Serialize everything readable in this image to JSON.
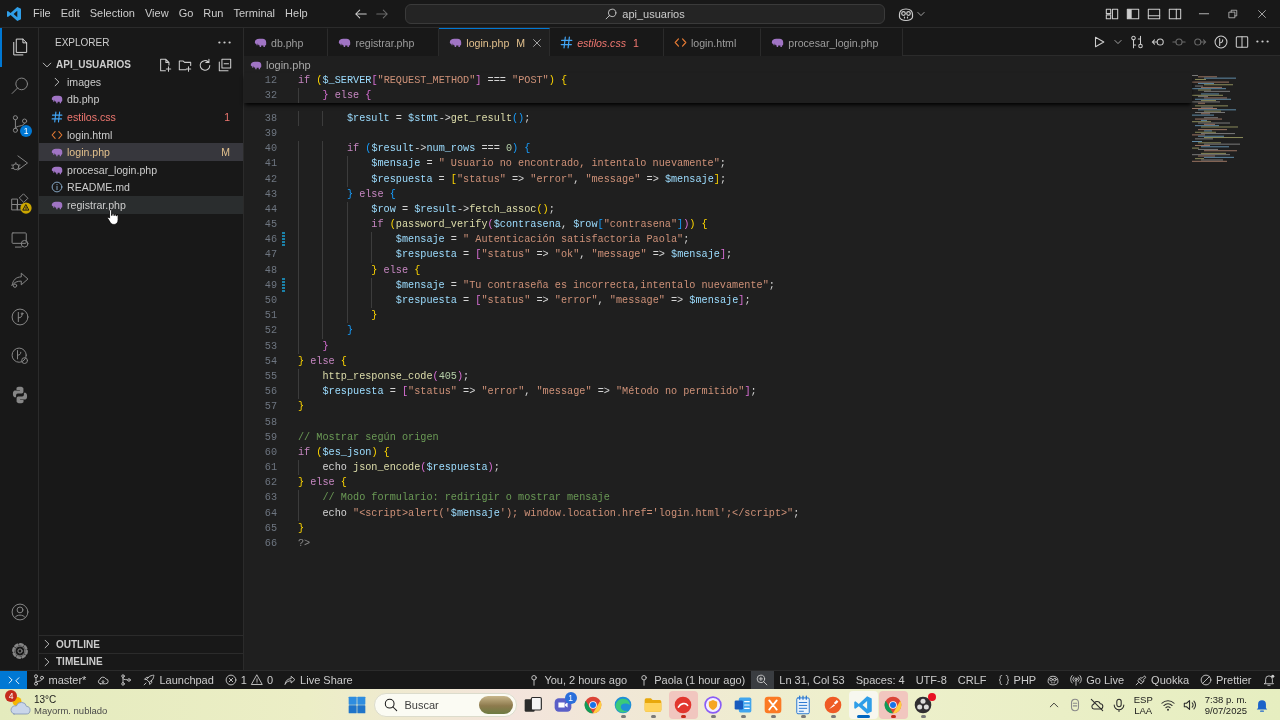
{
  "title_bar": {
    "menu": [
      "File",
      "Edit",
      "Selection",
      "View",
      "Go",
      "Run",
      "Terminal",
      "Help"
    ],
    "command_center": "api_usuarios"
  },
  "activity_bar": {
    "items": [
      {
        "kind": "explorer",
        "selected": true,
        "warning": false
      },
      {
        "kind": "search",
        "selected": false,
        "warning": false
      },
      {
        "kind": "source-control",
        "selected": false,
        "warning": false,
        "badge": "1"
      },
      {
        "kind": "run-debug",
        "selected": false,
        "warning": false
      },
      {
        "kind": "extensions",
        "selected": false,
        "warning": true
      },
      {
        "kind": "remote",
        "selected": false,
        "warning": false
      },
      {
        "kind": "live-share",
        "selected": false,
        "warning": false
      },
      {
        "kind": "git-graph",
        "selected": false,
        "warning": false
      },
      {
        "kind": "testing",
        "selected": false,
        "warning": false
      },
      {
        "kind": "python",
        "selected": false,
        "warning": false
      }
    ],
    "bottom": [
      {
        "kind": "account"
      },
      {
        "kind": "settings"
      }
    ]
  },
  "sidebar": {
    "title": "EXPLORER",
    "section": {
      "label": "API_USUARIOS",
      "expanded": true
    },
    "items": [
      {
        "kind": "folder",
        "label": "images",
        "expanded": false,
        "selected": false,
        "hovered": false
      },
      {
        "kind": "php",
        "label": "db.php",
        "selected": false,
        "hovered": false
      },
      {
        "kind": "css",
        "label": "estilos.css",
        "selected": false,
        "hovered": false,
        "decoration": {
          "kind": "error",
          "text": "1"
        }
      },
      {
        "kind": "html",
        "label": "login.html",
        "selected": false,
        "hovered": false
      },
      {
        "kind": "php",
        "label": "login.php",
        "selected": true,
        "hovered": false,
        "decoration": {
          "kind": "modified",
          "text": "M"
        }
      },
      {
        "kind": "php",
        "label": "procesar_login.php",
        "selected": false,
        "hovered": false
      },
      {
        "kind": "info",
        "label": "README.md",
        "selected": false,
        "hovered": false
      },
      {
        "kind": "php",
        "label": "registrar.php",
        "selected": false,
        "hovered": true
      }
    ],
    "panels": [
      {
        "label": "OUTLINE",
        "expanded": false
      },
      {
        "label": "TIMELINE",
        "expanded": false
      }
    ]
  },
  "editor": {
    "tabs": [
      {
        "kind": "php",
        "label": "db.php",
        "selected": false,
        "preview": false
      },
      {
        "kind": "php",
        "label": "registrar.php",
        "selected": false,
        "preview": false
      },
      {
        "kind": "php",
        "label": "login.php",
        "selected": true,
        "preview": false,
        "decoration": {
          "kind": "modified",
          "text": "M"
        }
      },
      {
        "kind": "css",
        "label": "estilos.css",
        "selected": false,
        "preview": true,
        "decoration": {
          "kind": "error",
          "text": "1"
        }
      },
      {
        "kind": "html",
        "label": "login.html",
        "selected": false,
        "preview": false
      },
      {
        "kind": "php",
        "label": "procesar_login.php",
        "selected": false,
        "preview": false
      }
    ],
    "breadcrumb": {
      "kind": "php",
      "label": "login.php"
    },
    "sticky_lines": [
      {
        "number": "12",
        "code": [
          {
            "kind": "keyword",
            "text": "if "
          },
          {
            "kind": "bracket-1",
            "text": "("
          },
          {
            "kind": "variable",
            "text": "$_SERVER"
          },
          {
            "kind": "bracket-2",
            "text": "["
          },
          {
            "kind": "string",
            "text": "\"REQUEST_METHOD\""
          },
          {
            "kind": "bracket-2",
            "text": "]"
          },
          {
            "kind": "plain",
            "text": " === "
          },
          {
            "kind": "string",
            "text": "\"POST\""
          },
          {
            "kind": "bracket-1",
            "text": ") {"
          }
        ]
      },
      {
        "number": "32",
        "code": [
          {
            "kind": "bracket-2",
            "text": "    }"
          },
          {
            "kind": "keyword",
            "text": " else "
          },
          {
            "kind": "bracket-2",
            "text": "{"
          }
        ]
      }
    ],
    "lines": [
      {
        "number": "38",
        "modified": false,
        "code": [
          {
            "kind": "variable",
            "text": "        $result"
          },
          {
            "kind": "plain",
            "text": " = "
          },
          {
            "kind": "variable",
            "text": "$stmt"
          },
          {
            "kind": "plain",
            "text": "->"
          },
          {
            "kind": "function",
            "text": "get_result"
          },
          {
            "kind": "bracket-3",
            "text": "()"
          },
          {
            "kind": "plain",
            "text": ";"
          }
        ]
      },
      {
        "number": "39",
        "modified": false
      },
      {
        "number": "40",
        "modified": false,
        "code": [
          {
            "kind": "keyword",
            "text": "        if "
          },
          {
            "kind": "bracket-3",
            "text": "("
          },
          {
            "kind": "variable",
            "text": "$result"
          },
          {
            "kind": "plain",
            "text": "->"
          },
          {
            "kind": "variable",
            "text": "num_rows"
          },
          {
            "kind": "plain",
            "text": " === "
          },
          {
            "kind": "number",
            "text": "0"
          },
          {
            "kind": "bracket-3",
            "text": ") {"
          }
        ]
      },
      {
        "number": "41",
        "modified": false,
        "code": [
          {
            "kind": "variable",
            "text": "            $mensaje"
          },
          {
            "kind": "plain",
            "text": " = "
          },
          {
            "kind": "string",
            "text": "\" Usuario no encontrado, intentalo nuevamente\""
          },
          {
            "kind": "plain",
            "text": ";"
          }
        ]
      },
      {
        "number": "42",
        "modified": false,
        "code": [
          {
            "kind": "variable",
            "text": "            $respuesta"
          },
          {
            "kind": "plain",
            "text": " = "
          },
          {
            "kind": "bracket-1",
            "text": "["
          },
          {
            "kind": "string",
            "text": "\"status\""
          },
          {
            "kind": "plain",
            "text": " => "
          },
          {
            "kind": "string",
            "text": "\"error\""
          },
          {
            "kind": "plain",
            "text": ", "
          },
          {
            "kind": "string",
            "text": "\"message\""
          },
          {
            "kind": "plain",
            "text": " => "
          },
          {
            "kind": "variable",
            "text": "$mensaje"
          },
          {
            "kind": "bracket-1",
            "text": "]"
          },
          {
            "kind": "plain",
            "text": ";"
          }
        ]
      },
      {
        "number": "43",
        "modified": false,
        "code": [
          {
            "kind": "bracket-3",
            "text": "        }"
          },
          {
            "kind": "keyword",
            "text": " else "
          },
          {
            "kind": "bracket-3",
            "text": "{"
          }
        ]
      },
      {
        "number": "44",
        "modified": false,
        "code": [
          {
            "kind": "variable",
            "text": "            $row"
          },
          {
            "kind": "plain",
            "text": " = "
          },
          {
            "kind": "variable",
            "text": "$result"
          },
          {
            "kind": "plain",
            "text": "->"
          },
          {
            "kind": "function",
            "text": "fetch_assoc"
          },
          {
            "kind": "bracket-1",
            "text": "()"
          },
          {
            "kind": "plain",
            "text": ";"
          }
        ]
      },
      {
        "number": "45",
        "modified": false,
        "code": [
          {
            "kind": "keyword",
            "text": "            if "
          },
          {
            "kind": "bracket-1",
            "text": "("
          },
          {
            "kind": "function",
            "text": "password_verify"
          },
          {
            "kind": "bracket-2",
            "text": "("
          },
          {
            "kind": "variable",
            "text": "$contrasena"
          },
          {
            "kind": "plain",
            "text": ", "
          },
          {
            "kind": "variable",
            "text": "$row"
          },
          {
            "kind": "bracket-3",
            "text": "["
          },
          {
            "kind": "string",
            "text": "\"contrasena\""
          },
          {
            "kind": "bracket-3",
            "text": "]"
          },
          {
            "kind": "bracket-2",
            "text": ")"
          },
          {
            "kind": "bracket-1",
            "text": ") {"
          }
        ]
      },
      {
        "number": "46",
        "modified": true,
        "code": [
          {
            "kind": "variable",
            "text": "                $mensaje"
          },
          {
            "kind": "plain",
            "text": " = "
          },
          {
            "kind": "string",
            "text": "\" Autenticación satisfactoria Paola\""
          },
          {
            "kind": "plain",
            "text": ";"
          }
        ]
      },
      {
        "number": "47",
        "modified": false,
        "code": [
          {
            "kind": "variable",
            "text": "                $respuesta"
          },
          {
            "kind": "plain",
            "text": " = "
          },
          {
            "kind": "bracket-2",
            "text": "["
          },
          {
            "kind": "string",
            "text": "\"status\""
          },
          {
            "kind": "plain",
            "text": " => "
          },
          {
            "kind": "string",
            "text": "\"ok\""
          },
          {
            "kind": "plain",
            "text": ", "
          },
          {
            "kind": "string",
            "text": "\"message\""
          },
          {
            "kind": "plain",
            "text": " => "
          },
          {
            "kind": "variable",
            "text": "$mensaje"
          },
          {
            "kind": "bracket-2",
            "text": "]"
          },
          {
            "kind": "plain",
            "text": ";"
          }
        ]
      },
      {
        "number": "48",
        "modified": false,
        "code": [
          {
            "kind": "bracket-1",
            "text": "            }"
          },
          {
            "kind": "keyword",
            "text": " else "
          },
          {
            "kind": "bracket-1",
            "text": "{"
          }
        ]
      },
      {
        "number": "49",
        "modified": true,
        "code": [
          {
            "kind": "variable",
            "text": "                $mensaje"
          },
          {
            "kind": "plain",
            "text": " = "
          },
          {
            "kind": "string",
            "text": "\"Tu contraseña es incorrecta,intentalo nuevamente\""
          },
          {
            "kind": "plain",
            "text": ";"
          }
        ]
      },
      {
        "number": "50",
        "modified": false,
        "code": [
          {
            "kind": "variable",
            "text": "                $respuesta"
          },
          {
            "kind": "plain",
            "text": " = "
          },
          {
            "kind": "bracket-2",
            "text": "["
          },
          {
            "kind": "string",
            "text": "\"status\""
          },
          {
            "kind": "plain",
            "text": " => "
          },
          {
            "kind": "string",
            "text": "\"error\""
          },
          {
            "kind": "plain",
            "text": ", "
          },
          {
            "kind": "string",
            "text": "\"message\""
          },
          {
            "kind": "plain",
            "text": " => "
          },
          {
            "kind": "variable",
            "text": "$mensaje"
          },
          {
            "kind": "bracket-2",
            "text": "]"
          },
          {
            "kind": "plain",
            "text": ";"
          }
        ]
      },
      {
        "number": "51",
        "modified": false,
        "code": [
          {
            "kind": "bracket-1",
            "text": "            }"
          }
        ]
      },
      {
        "number": "52",
        "modified": false,
        "code": [
          {
            "kind": "bracket-3",
            "text": "        }"
          }
        ]
      },
      {
        "number": "53",
        "modified": false,
        "code": [
          {
            "kind": "bracket-2",
            "text": "    }"
          }
        ]
      },
      {
        "number": "54",
        "modified": false,
        "code": [
          {
            "kind": "bracket-1",
            "text": "}"
          },
          {
            "kind": "keyword",
            "text": " else "
          },
          {
            "kind": "bracket-1",
            "text": "{"
          }
        ]
      },
      {
        "number": "55",
        "modified": false,
        "code": [
          {
            "kind": "function",
            "text": "    http_response_code"
          },
          {
            "kind": "bracket-2",
            "text": "("
          },
          {
            "kind": "number",
            "text": "405"
          },
          {
            "kind": "bracket-2",
            "text": ")"
          },
          {
            "kind": "plain",
            "text": ";"
          }
        ]
      },
      {
        "number": "56",
        "modified": false,
        "code": [
          {
            "kind": "variable",
            "text": "    $respuesta"
          },
          {
            "kind": "plain",
            "text": " = "
          },
          {
            "kind": "bracket-2",
            "text": "["
          },
          {
            "kind": "string",
            "text": "\"status\""
          },
          {
            "kind": "plain",
            "text": " => "
          },
          {
            "kind": "string",
            "text": "\"error\""
          },
          {
            "kind": "plain",
            "text": ", "
          },
          {
            "kind": "string",
            "text": "\"message\""
          },
          {
            "kind": "plain",
            "text": " => "
          },
          {
            "kind": "string",
            "text": "\"Método no permitido\""
          },
          {
            "kind": "bracket-2",
            "text": "]"
          },
          {
            "kind": "plain",
            "text": ";"
          }
        ]
      },
      {
        "number": "57",
        "modified": false,
        "code": [
          {
            "kind": "bracket-1",
            "text": "}"
          }
        ]
      },
      {
        "number": "58",
        "modified": false
      },
      {
        "number": "59",
        "modified": false,
        "code": [
          {
            "kind": "comment",
            "text": "// Mostrar según origen"
          }
        ]
      },
      {
        "number": "60",
        "modified": false,
        "code": [
          {
            "kind": "keyword",
            "text": "if "
          },
          {
            "kind": "bracket-1",
            "text": "("
          },
          {
            "kind": "variable",
            "text": "$es_json"
          },
          {
            "kind": "bracket-1",
            "text": ") {"
          }
        ]
      },
      {
        "number": "61",
        "modified": false,
        "code": [
          {
            "kind": "plain",
            "text": "    echo "
          },
          {
            "kind": "function",
            "text": "json_encode"
          },
          {
            "kind": "bracket-2",
            "text": "("
          },
          {
            "kind": "variable",
            "text": "$respuesta"
          },
          {
            "kind": "bracket-2",
            "text": ")"
          },
          {
            "kind": "plain",
            "text": ";"
          }
        ]
      },
      {
        "number": "62",
        "modified": false,
        "code": [
          {
            "kind": "bracket-1",
            "text": "}"
          },
          {
            "kind": "keyword",
            "text": " else "
          },
          {
            "kind": "bracket-1",
            "text": "{"
          }
        ]
      },
      {
        "number": "63",
        "modified": false,
        "code": [
          {
            "kind": "comment",
            "text": "    // Modo formulario: redirigir o mostrar mensaje"
          }
        ]
      },
      {
        "number": "64",
        "modified": false,
        "code": [
          {
            "kind": "plain",
            "text": "    echo "
          },
          {
            "kind": "string",
            "text": "\"<script>alert('"
          },
          {
            "kind": "variable",
            "text": "$mensaje"
          },
          {
            "kind": "string",
            "text": "'); window.location.href='login.html';</script>\""
          },
          {
            "kind": "plain",
            "text": ";"
          }
        ]
      },
      {
        "number": "65",
        "modified": false,
        "code": [
          {
            "kind": "bracket-1",
            "text": "}"
          }
        ]
      },
      {
        "number": "66",
        "modified": false,
        "code": [
          {
            "kind": "tag",
            "text": "?>"
          }
        ]
      }
    ]
  },
  "status_bar": {
    "left": [
      {
        "kind": "remote"
      },
      {
        "kind": "branch",
        "text": "master*"
      },
      {
        "kind": "sync"
      },
      {
        "kind": "graph"
      },
      {
        "kind": "launchpad",
        "text": "Launchpad"
      },
      {
        "kind": "problems",
        "errors": "1",
        "warnings": "0"
      },
      {
        "kind": "live-share",
        "text": "Live Share"
      }
    ],
    "right": [
      {
        "kind": "blame",
        "text": "You, 2 hours ago",
        "highlighted": false
      },
      {
        "kind": "blame",
        "text": "Paola (1 hour ago)",
        "highlighted": false
      },
      {
        "kind": "zoom",
        "highlighted": true
      },
      {
        "kind": "text",
        "text": "Ln 31, Col 53",
        "highlighted": false
      },
      {
        "kind": "text",
        "text": "Spaces: 4",
        "highlighted": false
      },
      {
        "kind": "text",
        "text": "UTF-8",
        "highlighted": false
      },
      {
        "kind": "text",
        "text": "CRLF",
        "highlighted": false
      },
      {
        "kind": "language",
        "text": "PHP",
        "highlighted": false
      },
      {
        "kind": "copilot",
        "highlighted": false
      },
      {
        "kind": "go-live",
        "text": "Go Live",
        "highlighted": false
      },
      {
        "kind": "quokka",
        "text": "Quokka",
        "highlighted": false
      },
      {
        "kind": "prettier",
        "text": "Prettier",
        "highlighted": false
      },
      {
        "kind": "notifications",
        "highlighted": false
      }
    ]
  },
  "taskbar": {
    "weather": {
      "badge": "4",
      "temperature": "13°C",
      "condition": "Mayorm. nublado"
    },
    "search": {
      "placeholder": "Buscar"
    },
    "apps": [
      {
        "kind": "start",
        "running": false,
        "selected": false,
        "flashing": false,
        "alert": false
      },
      {
        "kind": "task-view",
        "running": false,
        "selected": false,
        "flashing": false,
        "alert": false
      },
      {
        "kind": "chat",
        "badge": "1",
        "running": false,
        "selected": false,
        "flashing": false,
        "alert": false
      },
      {
        "kind": "chrome",
        "running": false,
        "selected": false,
        "flashing": false,
        "alert": false
      },
      {
        "kind": "edge",
        "running": true,
        "selected": false,
        "flashing": false,
        "alert": false
      },
      {
        "kind": "files",
        "running": true,
        "selected": false,
        "flashing": false,
        "alert": false
      },
      {
        "kind": "ea",
        "running": true,
        "selected": false,
        "flashing": true,
        "alert": false
      },
      {
        "kind": "vpn",
        "running": true,
        "selected": false,
        "flashing": false,
        "alert": false
      },
      {
        "kind": "word",
        "running": true,
        "selected": false,
        "flashing": false,
        "alert": false
      },
      {
        "kind": "xampp",
        "running": true,
        "selected": false,
        "flashing": false,
        "alert": false
      },
      {
        "kind": "notepad",
        "running": true,
        "selected": false,
        "flashing": false,
        "alert": false
      },
      {
        "kind": "postman",
        "running": true,
        "selected": false,
        "flashing": false,
        "alert": false
      },
      {
        "kind": "vscode",
        "running": true,
        "selected": true,
        "flashing": false,
        "alert": false
      },
      {
        "kind": "chrome",
        "running": true,
        "selected": false,
        "flashing": true,
        "alert": false
      },
      {
        "kind": "obs",
        "running": true,
        "selected": false,
        "flashing": false,
        "alert": true
      }
    ],
    "tray": {
      "language": "ESP",
      "layout": "LAA",
      "time": "7:38 p. m.",
      "date": "9/07/2025"
    }
  }
}
